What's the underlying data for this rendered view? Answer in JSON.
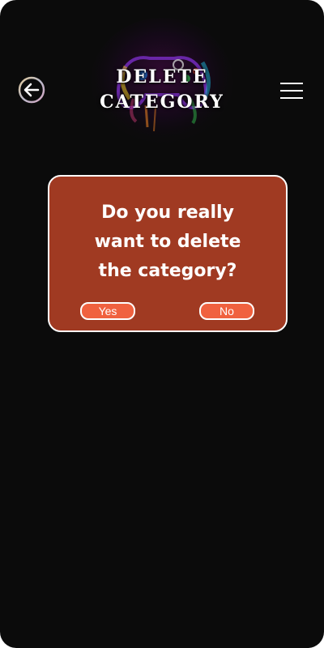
{
  "header": {
    "title_line1": "DELETE",
    "title_line2": "CATEGORY",
    "back_icon": "arrow-left-circle-icon",
    "menu_icon": "hamburger-menu-icon",
    "background_art": "neon-game-controller-splash"
  },
  "dialog": {
    "message_line1": "Do you really",
    "message_line2": "want to delete",
    "message_line3": "the category?",
    "yes_label": "Yes",
    "no_label": "No"
  },
  "colors": {
    "background": "#0b0b0b",
    "dialog_background": "#a03a22",
    "button_background": "#f0613f",
    "text": "#ffffff"
  }
}
